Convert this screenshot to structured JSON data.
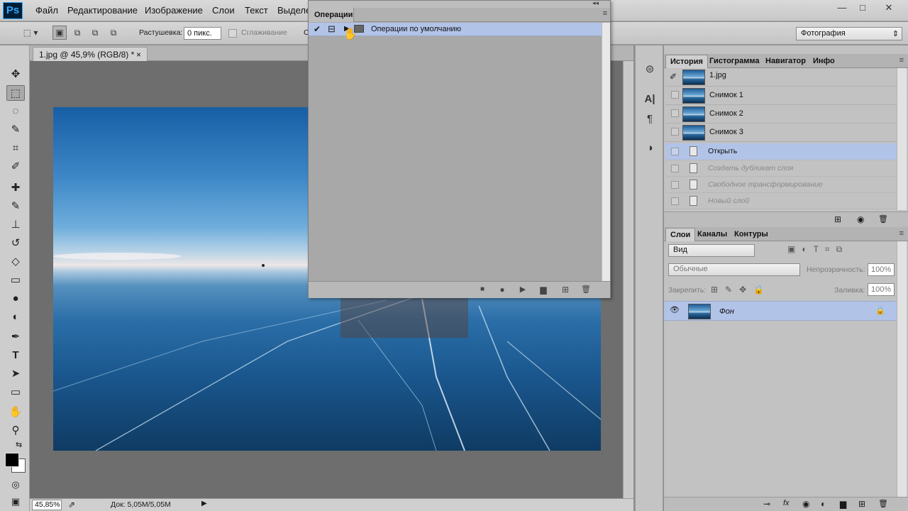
{
  "app": {
    "logo": "Ps"
  },
  "menu": [
    "Файл",
    "Редактирование",
    "Изображение",
    "Слои",
    "Текст",
    "Выделе"
  ],
  "window_controls": {
    "minimize": "—",
    "maximize": "□",
    "close": "✕"
  },
  "options_bar": {
    "feather_label": "Растушевка:",
    "feather_value": "0 пикс.",
    "antialias_label": "Сглаживание",
    "truncated_label": "С",
    "workspace": "Фотография",
    "workspace_arrow": "⇕"
  },
  "document": {
    "tab_title": "1.jpg @ 45,9% (RGB/8) *",
    "close": "×"
  },
  "status_bar": {
    "zoom": "45,85%",
    "doc_info": "Док: 5,05M/5,05M"
  },
  "actions_panel": {
    "tab": "Операции",
    "check": "✔",
    "toggle": "⊟",
    "expand": "▶",
    "set_name": "Операции по умолчанию",
    "menu_icon": "≡",
    "collapse_icon": "◂◂"
  },
  "history_panel": {
    "tabs": [
      "История",
      "Гистограмма",
      "Навигатор",
      "Инфо"
    ],
    "snapshots": [
      "1.jpg",
      "Снимок 1",
      "Снимок 2",
      "Снимок 3"
    ],
    "active_step": "Открыть",
    "steps": [
      "Создать дубликат слоя",
      "Свободное трансформирование",
      "Новый слой"
    ]
  },
  "layers_panel": {
    "tabs": [
      "Слои",
      "Каналы",
      "Контуры"
    ],
    "filter_label": "Вид",
    "blend_mode": "Обычные",
    "opacity_label": "Непрозрачность:",
    "opacity_value": "100%",
    "lock_label": "Закрепить:",
    "fill_label": "Заливка:",
    "fill_value": "100%",
    "layer_name": "Фон"
  },
  "icons": {
    "move": "✥",
    "marquee": "⬚",
    "lasso": "◌",
    "quick_select": "✎",
    "crop": "⌗",
    "eyedropper": "✐",
    "heal": "✚",
    "brush": "✎",
    "stamp": "⊥",
    "history_brush": "↺",
    "eraser": "◇",
    "gradient": "▭",
    "blur": "●",
    "dodge": "◐",
    "pen": "✒",
    "type": "T",
    "path_select": "➤",
    "shape": "▭",
    "hand": "✋",
    "zoom": "⚲",
    "swap": "⇆",
    "quickmask": "◎",
    "screen_mode": "▣",
    "stop": "■",
    "record": "●",
    "play": "▶",
    "folder": "▆",
    "new": "⊞",
    "trash": "🗑",
    "snapshot_brush": "✐",
    "layer_eye": "👁",
    "lock": "🔒",
    "camera": "◉",
    "link": "⊸",
    "fx": "fx"
  },
  "colors": {
    "selection_blue": "#b2c3e8",
    "panel_gray": "#c2c2c2"
  }
}
